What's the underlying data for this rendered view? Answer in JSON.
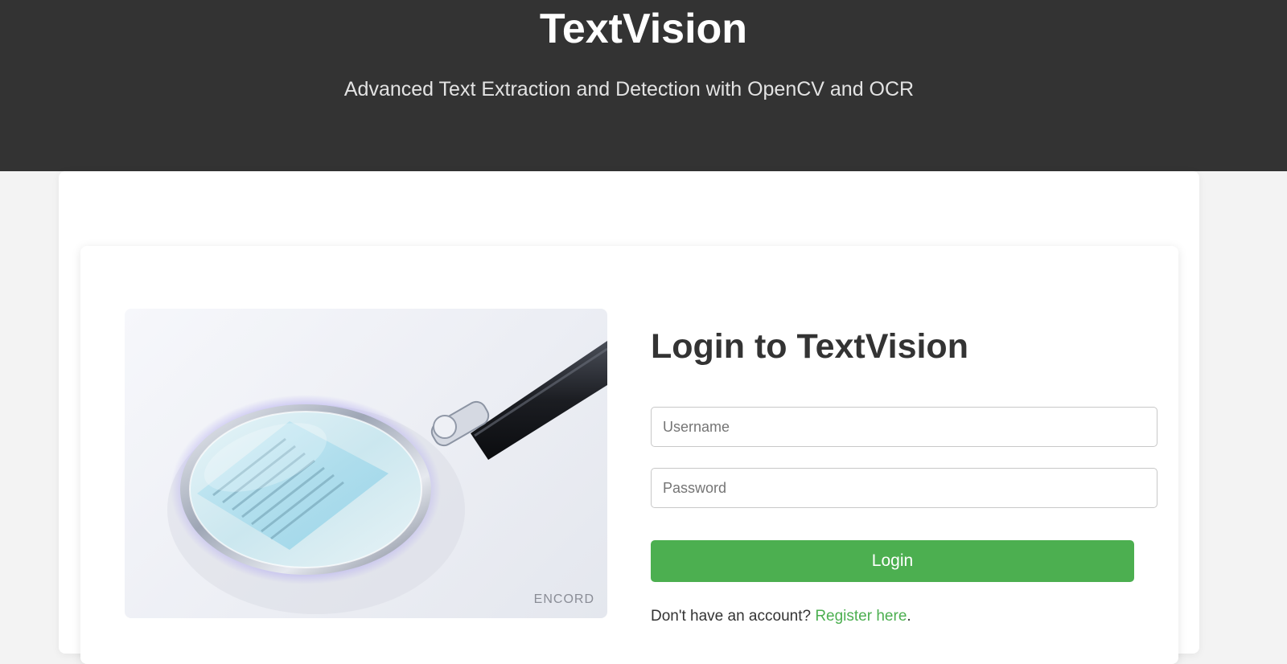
{
  "header": {
    "title": "TextVision",
    "subtitle": "Advanced Text Extraction and Detection with OpenCV and OCR"
  },
  "login": {
    "heading": "Login to TextVision",
    "username_placeholder": "Username",
    "password_placeholder": "Password",
    "submit_label": "Login",
    "register_prompt": "Don't have an account? ",
    "register_link": "Register here",
    "register_suffix": "."
  },
  "hero": {
    "icon": "magnifying-glass-over-document",
    "watermark": "ENCORD"
  },
  "colors": {
    "header_bg": "#333333",
    "accent": "#4caf50",
    "page_bg": "#f3f3f3"
  }
}
